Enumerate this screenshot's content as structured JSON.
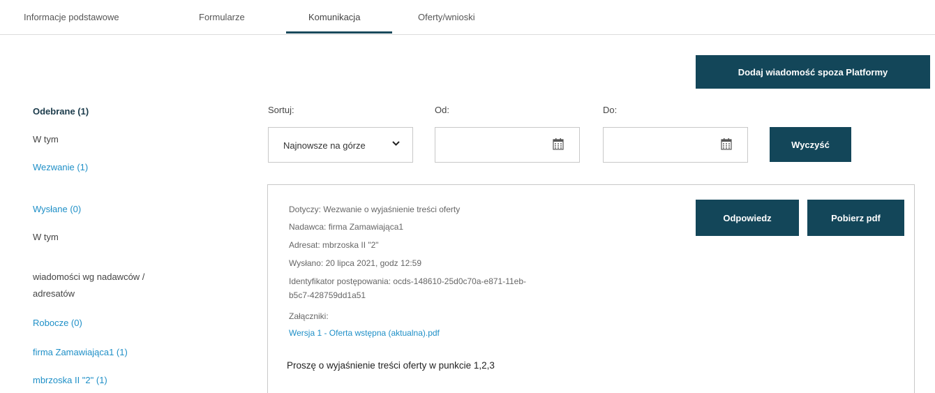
{
  "tabs": [
    {
      "label": "Informacje podstawowe"
    },
    {
      "label": "Formularze"
    },
    {
      "label": "Komunikacja"
    },
    {
      "label": "Oferty/wnioski"
    }
  ],
  "active_tab": "Komunikacja",
  "add_external_button": "Dodaj wiadomość spoza Platformy",
  "sidebar": {
    "received": "Odebrane (1)",
    "in_it_1": "W tym",
    "summons": "Wezwanie (1)",
    "sent": "Wysłane (0)",
    "in_it_2": "W tym",
    "by_sender_line1": "wiadomości wg nadawców /",
    "by_sender_line2": "adresatów",
    "drafts": "Robocze (0)",
    "sender_1": "firma Zamawiająca1 (1)",
    "sender_2": "mbrzoska II \"2\" (1)"
  },
  "filters": {
    "sort_label": "Sortuj:",
    "sort_value": "Najnowsze na górze",
    "from_label": "Od:",
    "from_value": "",
    "to_label": "Do:",
    "to_value": "",
    "clear_button": "Wyczyść"
  },
  "message": {
    "subject": "Dotyczy: Wezwanie o wyjaśnienie treści oferty",
    "sender": "Nadawca: firma Zamawiająca1",
    "recipient": "Adresat: mbrzoska II \"2\"",
    "sent_at": "Wysłano: 20 lipca 2021, godz 12:59",
    "procedure_id_line1": "Identyfikator postępowania: ocds-148610-25d0c70a-e871-11eb-",
    "procedure_id_line2": "b5c7-428759dd1a51",
    "attachments_label": "Załączniki:",
    "attachment_link": "Wersja 1 - Oferta wstępna (aktualna).pdf",
    "body": "Proszę o wyjaśnienie treści oferty w punkcie 1,2,3",
    "reply_button": "Odpowiedz",
    "download_button": "Pobierz pdf"
  },
  "icons": {
    "dropdown": "chevron-down-icon",
    "date": "calendar-icon"
  },
  "colors": {
    "primary": "#134659",
    "link": "#1e8fc7"
  }
}
